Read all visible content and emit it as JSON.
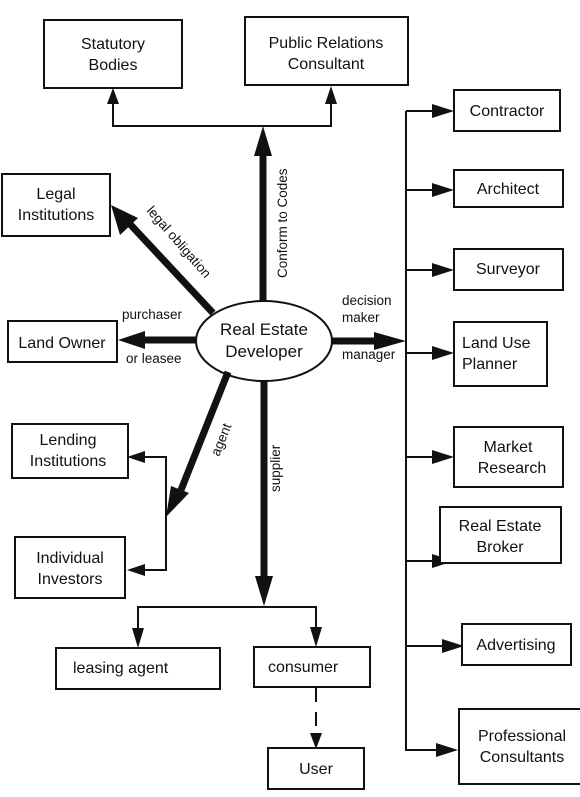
{
  "diagram": {
    "center": {
      "id": "developer",
      "lines": [
        "Real Estate",
        "Developer"
      ]
    },
    "nodes": {
      "statutory": {
        "lines": [
          "Statutory",
          "Bodies"
        ]
      },
      "pr": {
        "lines": [
          "Public  Relations",
          "Consultant"
        ]
      },
      "legal": {
        "lines": [
          "Legal",
          "Institutions"
        ]
      },
      "landowner": {
        "lines": [
          "Land Owner"
        ]
      },
      "lending": {
        "lines": [
          "Lending",
          "Institutions"
        ]
      },
      "investors": {
        "lines": [
          "Individual",
          "Investors"
        ]
      },
      "leasing": {
        "lines": [
          "leasing  agent"
        ]
      },
      "consumer": {
        "lines": [
          "consumer"
        ]
      },
      "user": {
        "lines": [
          "User"
        ]
      },
      "contractor": {
        "lines": [
          "Contractor"
        ]
      },
      "architect": {
        "lines": [
          "Architect"
        ]
      },
      "surveyor": {
        "lines": [
          "Surveyor"
        ]
      },
      "landuse": {
        "lines": [
          "Land Use",
          "Planner"
        ]
      },
      "market": {
        "lines": [
          "Market",
          "Research"
        ]
      },
      "broker": {
        "lines": [
          "Real Estate",
          "Broker"
        ]
      },
      "advertising": {
        "lines": [
          "Advertising"
        ]
      },
      "professional": {
        "lines": [
          "Professional",
          "Consultants"
        ]
      }
    },
    "edge_labels": {
      "conform": "Conform to Codes",
      "legal_obligation": "legal obligation",
      "purchaser": "purchaser",
      "or_leasee": "or leasee",
      "decision": "decision",
      "maker": "maker",
      "manager": "manager",
      "agent": "agent",
      "supplier": "supplier"
    },
    "edges": [
      {
        "from": "developer",
        "to": "statutory",
        "label": "Conform to Codes"
      },
      {
        "from": "developer",
        "to": "pr",
        "label": "Conform to Codes"
      },
      {
        "from": "developer",
        "to": "legal",
        "label": "legal obligation"
      },
      {
        "from": "developer",
        "to": "landowner",
        "label": "purchaser or leasee"
      },
      {
        "from": "developer",
        "to": "lending",
        "label": "agent"
      },
      {
        "from": "developer",
        "to": "investors",
        "label": "agent"
      },
      {
        "from": "developer",
        "to": "leasing",
        "label": "supplier"
      },
      {
        "from": "developer",
        "to": "consumer",
        "label": "supplier"
      },
      {
        "from": "consumer",
        "to": "user",
        "label": "",
        "style": "dashed"
      },
      {
        "from": "developer",
        "to": "contractor",
        "label": "decision maker / manager"
      },
      {
        "from": "developer",
        "to": "architect",
        "label": "decision maker / manager"
      },
      {
        "from": "developer",
        "to": "surveyor",
        "label": "decision maker / manager"
      },
      {
        "from": "developer",
        "to": "landuse",
        "label": "decision maker / manager"
      },
      {
        "from": "developer",
        "to": "market",
        "label": "decision maker / manager"
      },
      {
        "from": "developer",
        "to": "broker",
        "label": "decision maker / manager"
      },
      {
        "from": "developer",
        "to": "advertising",
        "label": "decision maker / manager"
      },
      {
        "from": "developer",
        "to": "professional",
        "label": "decision maker / manager"
      }
    ]
  }
}
